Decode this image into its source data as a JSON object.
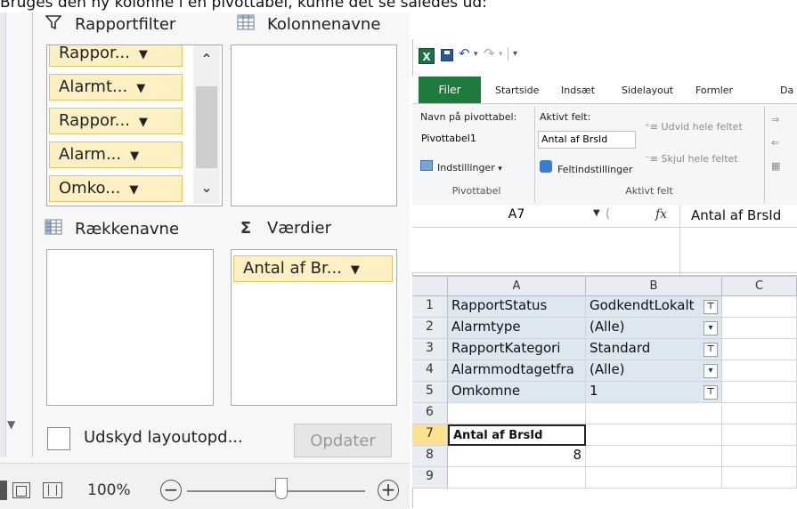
{
  "caption": "Bruges den ny kolonne i en pivottabel, kunne det se således ud:",
  "field_list": {
    "zones": {
      "report_filter": "Rapportfilter",
      "column_labels": "Kolonnenavne",
      "row_labels": "Rækkenavne",
      "values": "Værdier"
    },
    "filter_fields": [
      "Rappor...",
      "Alarmt...",
      "Rappor...",
      "Alarm...",
      "Omko..."
    ],
    "value_fields": [
      "Antal af Br..."
    ],
    "defer_label": "Udskyd layoutopd...",
    "update_button": "Opdater",
    "zoom": "100%"
  },
  "excel": {
    "icons": [
      "excel-logo-icon",
      "save-icon",
      "undo-icon",
      "redo-icon"
    ],
    "tabs": [
      "Filer",
      "Startside",
      "Indsæt",
      "Sidelayout",
      "Formler",
      "Da"
    ],
    "ribbon": {
      "pivot_name_label": "Navn på pivottabel:",
      "pivot_name_value": "Pivottabel1",
      "options_label": "Indstillinger",
      "group_pivot": "Pivottabel",
      "active_field_label": "Aktivt felt:",
      "active_field_value": "Antal af BrsId",
      "field_settings": "Feltindstillinger",
      "expand_field": "Udvid hele feltet",
      "collapse_field": "Skjul hele feltet",
      "group_active": "Aktivt felt"
    },
    "formula_bar": {
      "name_box": "A7",
      "fx": "fx",
      "content": "Antal af BrsId"
    },
    "columns": [
      "A",
      "B",
      "C"
    ],
    "rows": [
      {
        "n": "1",
        "a": "RapportStatus",
        "b": "GodkendtLokalt",
        "filter": "active"
      },
      {
        "n": "2",
        "a": "Alarmtype",
        "b": "(Alle)",
        "filter": "dropdown"
      },
      {
        "n": "3",
        "a": "RapportKategori",
        "b": "Standard",
        "filter": "active"
      },
      {
        "n": "4",
        "a": "Alarmmodtagetfra",
        "b": "(Alle)",
        "filter": "dropdown"
      },
      {
        "n": "5",
        "a": "Omkomne",
        "b": "1",
        "filter": "active"
      },
      {
        "n": "6",
        "a": "",
        "b": "",
        "filter": "none"
      },
      {
        "n": "7",
        "a": "Antal af BrsId",
        "b": "",
        "filter": "none"
      },
      {
        "n": "8",
        "a": "8",
        "b": "",
        "filter": "none"
      },
      {
        "n": "9",
        "a": "",
        "b": "",
        "filter": "none"
      }
    ]
  }
}
